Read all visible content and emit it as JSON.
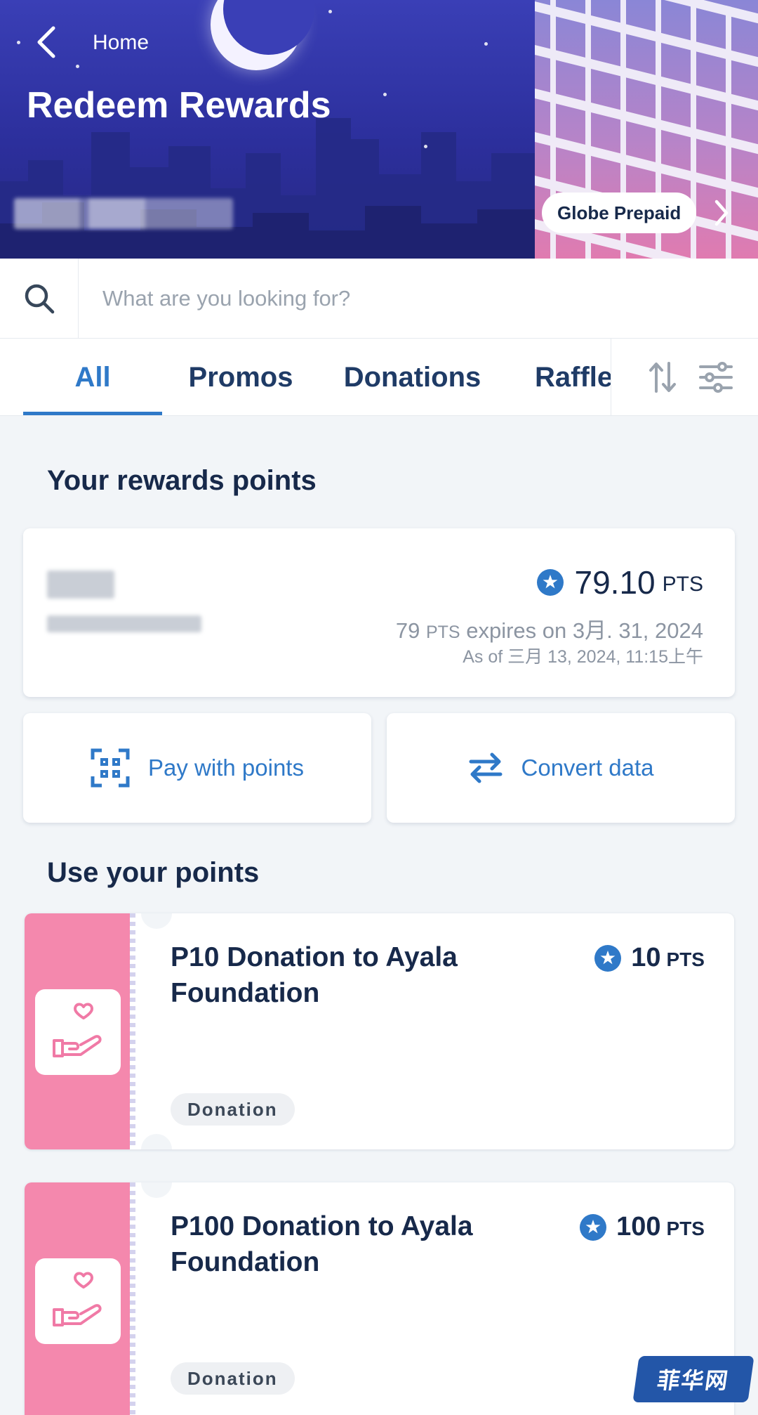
{
  "header": {
    "back_label": "Home",
    "title": "Redeem Rewards",
    "brand_pill": "Globe Prepaid"
  },
  "search": {
    "placeholder": "What are you looking for?",
    "value": ""
  },
  "tabs": [
    {
      "label": "All",
      "active": true
    },
    {
      "label": "Promos",
      "active": false
    },
    {
      "label": "Donations",
      "active": false
    },
    {
      "label": "Raffles",
      "active": false
    }
  ],
  "points_section": {
    "title": "Your rewards points",
    "points_value": "79.10",
    "points_unit": "PTS",
    "expires_amount": "79",
    "expires_unit": "PTS",
    "expires_text": "expires on 3月. 31, 2024",
    "as_of": "As of 三月 13, 2024, 11:15上午"
  },
  "actions": {
    "pay_label": "Pay with points",
    "convert_label": "Convert data"
  },
  "use_section": {
    "title": "Use your points"
  },
  "rewards": [
    {
      "title": "P10 Donation to Ayala Foundation",
      "points": "10",
      "unit": "PTS",
      "badge": "Donation"
    },
    {
      "title": "P100 Donation to Ayala Foundation",
      "points": "100",
      "unit": "PTS",
      "badge": "Donation"
    }
  ],
  "watermark": "菲华网",
  "colors": {
    "accent": "#2f79c8",
    "text_dark": "#17294a",
    "reward_pink": "#f488ad",
    "header_blue": "#2c2f9c"
  }
}
